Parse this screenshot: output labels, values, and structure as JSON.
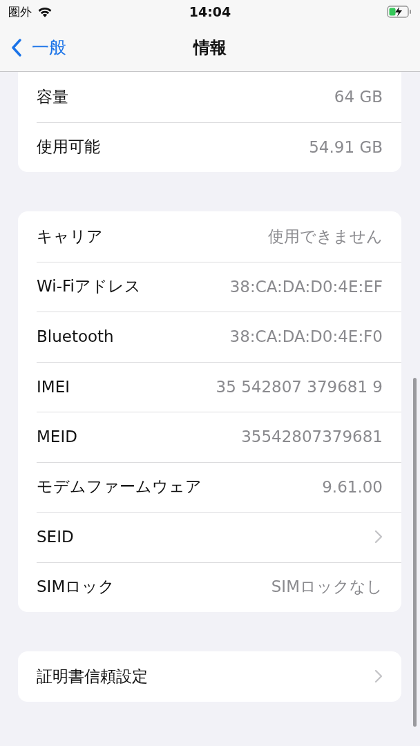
{
  "status_bar": {
    "carrier": "圏外",
    "time": "14:04"
  },
  "nav": {
    "back": "一般",
    "title": "情報"
  },
  "groups": [
    {
      "rows": [
        {
          "kind": "value",
          "label": "容量",
          "value": "64 GB"
        },
        {
          "kind": "value",
          "label": "使用可能",
          "value": "54.91 GB"
        }
      ]
    },
    {
      "rows": [
        {
          "kind": "value",
          "label": "キャリア",
          "value": "使用できません"
        },
        {
          "kind": "value",
          "label": "Wi-Fiアドレス",
          "value": "38:CA:DA:D0:4E:EF"
        },
        {
          "kind": "value",
          "label": "Bluetooth",
          "value": "38:CA:DA:D0:4E:F0"
        },
        {
          "kind": "value",
          "label": "IMEI",
          "value": "35 542807 379681 9"
        },
        {
          "kind": "value",
          "label": "MEID",
          "value": "35542807379681"
        },
        {
          "kind": "value",
          "label": "モデムファームウェア",
          "value": "9.61.00"
        },
        {
          "kind": "link",
          "label": "SEID"
        },
        {
          "kind": "value",
          "label": "SIMロック",
          "value": "SIMロックなし"
        }
      ]
    },
    {
      "rows": [
        {
          "kind": "link",
          "label": "証明書信頼設定"
        }
      ]
    }
  ]
}
